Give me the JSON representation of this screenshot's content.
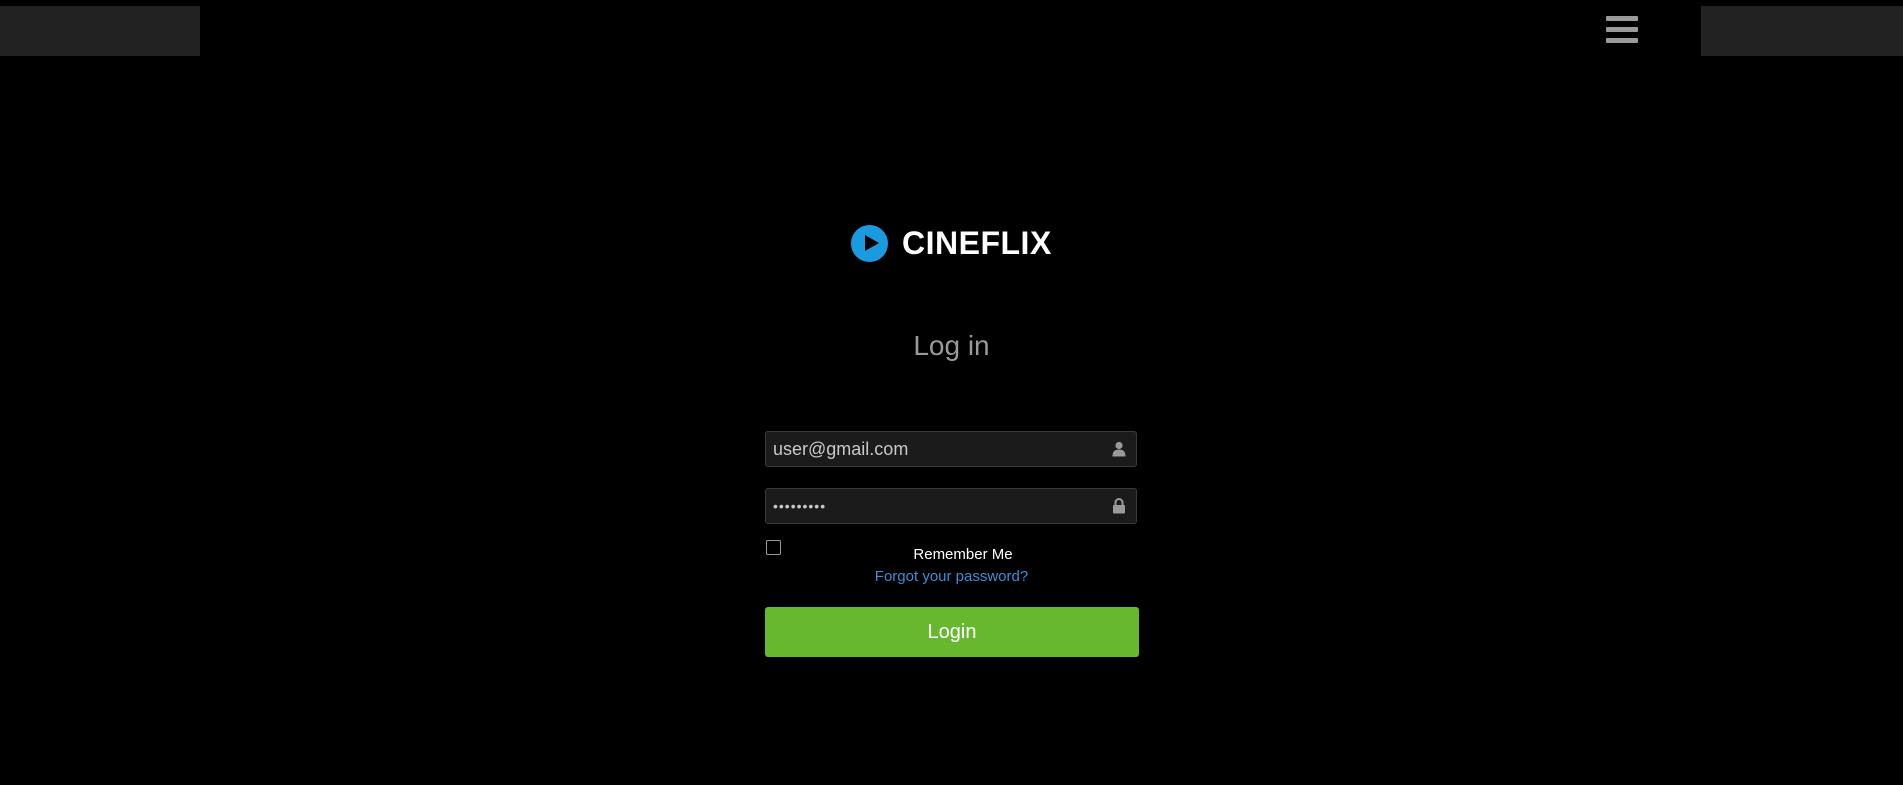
{
  "brand": {
    "name": "CINEFLIX",
    "logo_color": "#1a9be0"
  },
  "header": {
    "menu_icon": "hamburger-menu-icon"
  },
  "login": {
    "title": "Log in",
    "email_value": "user@gmail.com",
    "email_icon": "user-icon",
    "password_value": "•••••••••",
    "password_icon": "lock-icon",
    "remember_label": "Remember Me",
    "remember_checked": false,
    "forgot_link": "Forgot your password?",
    "submit_label": "Login",
    "submit_color": "#67b82e"
  }
}
